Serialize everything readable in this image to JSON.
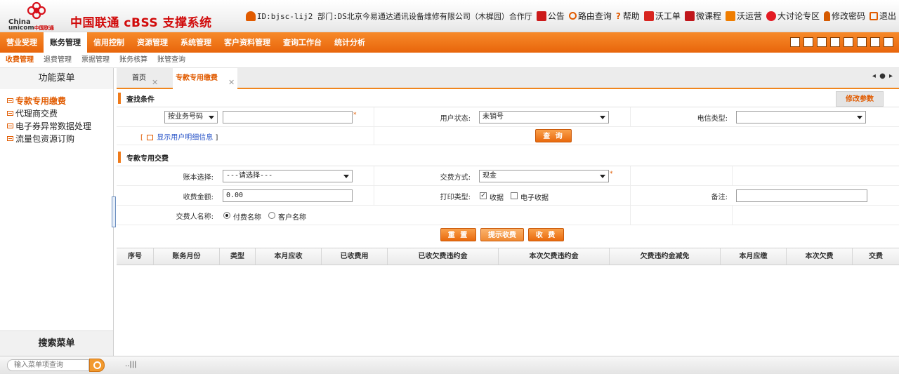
{
  "header": {
    "logo_text": "China unicom中国联通",
    "logo_line1": "China",
    "logo_line2": "unicom",
    "logo_cn": "中国联通",
    "system_title": "中国联通 cBSS 支撑系统",
    "user_info": "ID:bjsc-lij2 部门:DS北京今易通达通讯设备维修有限公司（木樨园）合作厅",
    "links": [
      {
        "label": "公告",
        "icon": "announcement-icon"
      },
      {
        "label": "路由查询",
        "icon": "search-icon"
      },
      {
        "label": "帮助",
        "icon": "help-icon"
      },
      {
        "label": "沃工单",
        "icon": "ticket-icon"
      },
      {
        "label": "微课程",
        "icon": "course-icon"
      },
      {
        "label": "沃运营",
        "icon": "operations-icon"
      },
      {
        "label": "大讨论专区",
        "icon": "forum-icon"
      },
      {
        "label": "修改密码",
        "icon": "key-icon"
      },
      {
        "label": "退出",
        "icon": "logout-icon"
      }
    ],
    "accent_color": "#e15b00",
    "title_color": "#d10a0a"
  },
  "main_nav": [
    "营业受理",
    "账务管理",
    "信用控制",
    "资源管理",
    "系统管理",
    "客户资料管理",
    "查询工作台",
    "统计分析"
  ],
  "main_nav_active": 1,
  "sub_nav": [
    "收费管理",
    "退费管理",
    "票据管理",
    "账务核算",
    "账管查询"
  ],
  "sub_nav_active": 0,
  "left_panel": {
    "title": "功能菜单",
    "items": [
      "专款专用缴费",
      "代理商交费",
      "电子券异常数据处理",
      "流量包资源订购"
    ],
    "active_index": 0,
    "search_title": "搜索菜单"
  },
  "footer": {
    "search_placeholder": "输入菜单项查询",
    "status_glyph": "..|||"
  },
  "tabs": [
    {
      "label": "首页",
      "active": false
    },
    {
      "label": "专款专用缴费",
      "active": true
    }
  ],
  "tab_arrows": "◂ ● ▸",
  "search_section": {
    "title": "查找条件",
    "edit_params_label": "修改参数",
    "query_type_value": "按业务号码",
    "query_value": "",
    "user_status_label": "用户状态:",
    "user_status_value": "未销号",
    "telecom_type_label": "电信类型:",
    "telecom_type_value": "",
    "show_detail_label": "显示用户明细信息",
    "show_detail_prefix": "[",
    "show_detail_suffix": "]",
    "query_button": "查 询"
  },
  "payment_section": {
    "title": "专款专用交费",
    "account_label": "账本选择:",
    "account_value": "---请选择---",
    "pay_method_label": "交费方式:",
    "pay_method_value": "现金",
    "amount_label": "收费金额:",
    "amount_value": "0.00",
    "print_type_label": "打印类型:",
    "print_options": [
      {
        "label": "收据",
        "checked": true
      },
      {
        "label": "电子收据",
        "checked": false
      }
    ],
    "remark_label": "备注:",
    "remark_value": "",
    "payer_label": "交费人名称:",
    "payer_options": [
      {
        "label": "付费名称",
        "selected": true
      },
      {
        "label": "客户名称",
        "selected": false
      }
    ],
    "buttons": [
      "重 置",
      "提示收费",
      "收 费"
    ]
  },
  "grid": {
    "columns": [
      "序号",
      "账务月份",
      "类型",
      "本月应收",
      "已收费用",
      "已收欠费违约金",
      "本次欠费违约金",
      "欠费违约金减免",
      "本月应缴",
      "本次欠费",
      "交费"
    ]
  }
}
